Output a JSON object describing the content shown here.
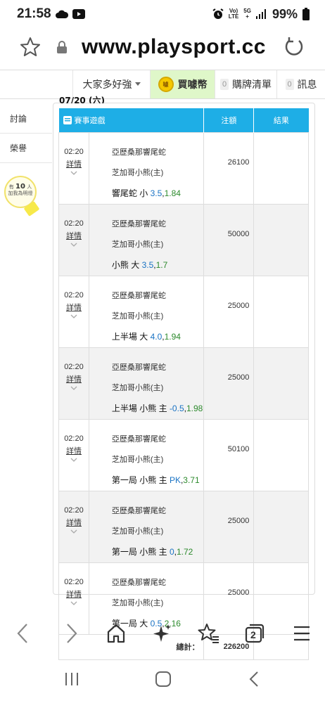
{
  "status": {
    "time": "21:58",
    "network_top": "Vo)",
    "network_bottom": "LTE",
    "signal_top": "5G",
    "signal_bottom": "+",
    "battery": "99%"
  },
  "browser": {
    "url": "www.playsport.cc"
  },
  "nav": {
    "item1": "大家多好強",
    "item2": "買噱幣",
    "item3_count": "0",
    "item3": "購牌清單",
    "item4_count": "0",
    "item4": "訊息"
  },
  "side": {
    "tab1": "討論",
    "tab2": "榮譽",
    "bulb_prefix": "有",
    "bulb_count": "10",
    "bulb_unit": "人",
    "bulb_line2": "加我為明燈"
  },
  "date_cut": "07/20 (六)",
  "table": {
    "headers": {
      "game": "賽事遊戲",
      "amount": "注額",
      "result": "結果"
    },
    "rows": [
      {
        "time": "02:20",
        "detail": "詳情",
        "home": "亞歷桑那響尾蛇",
        "away": "芝加哥小熊(主)",
        "pick_prefix": "響尾蛇 小 ",
        "line": "3.5",
        "sep": ",",
        "odds": "1.84",
        "amount": "26100"
      },
      {
        "time": "02:20",
        "detail": "詳情",
        "home": "亞歷桑那響尾蛇",
        "away": "芝加哥小熊(主)",
        "pick_prefix": "小熊 大 ",
        "line": "3.5",
        "sep": ",",
        "odds": "1.7",
        "amount": "50000"
      },
      {
        "time": "02:20",
        "detail": "詳情",
        "home": "亞歷桑那響尾蛇",
        "away": "芝加哥小熊(主)",
        "pick_prefix": "上半場 大 ",
        "line": "4.0",
        "sep": ",",
        "odds": "1.94",
        "amount": "25000"
      },
      {
        "time": "02:20",
        "detail": "詳情",
        "home": "亞歷桑那響尾蛇",
        "away": "芝加哥小熊(主)",
        "pick_prefix": "上半場 小熊 主 ",
        "line": "-0.5",
        "sep": ",",
        "odds": "1.98",
        "amount": "25000"
      },
      {
        "time": "02:20",
        "detail": "詳情",
        "home": "亞歷桑那響尾蛇",
        "away": "芝加哥小熊(主)",
        "pick_prefix": "第一局 小熊 主 ",
        "line": "PK",
        "sep": ",",
        "odds": "3.71",
        "amount": "50100"
      },
      {
        "time": "02:20",
        "detail": "詳情",
        "home": "亞歷桑那響尾蛇",
        "away": "芝加哥小熊(主)",
        "pick_prefix": "第一局 小熊 主 ",
        "line": "0",
        "sep": ",",
        "odds": "1.72",
        "amount": "25000"
      },
      {
        "time": "02:20",
        "detail": "詳情",
        "home": "亞歷桑那響尾蛇",
        "away": "芝加哥小熊(主)",
        "pick_prefix": "第一局 大 ",
        "line": "0.5",
        "sep": ",",
        "odds": "2.16",
        "amount": "25000"
      }
    ],
    "total_label": "總計：",
    "total_value": "226200"
  },
  "colors": {
    "header_blue": "#1eaee6",
    "line_blue": "#1a73c4",
    "odds_green": "#2d8a2d",
    "coin_nav_bg": "#dff7c9"
  },
  "icons": [
    "cloud-icon",
    "youtube-icon",
    "alarm-icon",
    "signal-icon",
    "battery-icon",
    "bookmark-star-icon",
    "lock-icon",
    "reload-icon",
    "chevron-down-icon",
    "coin-icon",
    "list-icon",
    "back-icon",
    "forward-icon",
    "home-icon",
    "sparkle-icon",
    "favorites-icon",
    "tabs-icon",
    "menu-icon",
    "recents-icon",
    "android-home-icon",
    "android-back-icon"
  ],
  "toolbar": {
    "tabs_count": "2"
  }
}
